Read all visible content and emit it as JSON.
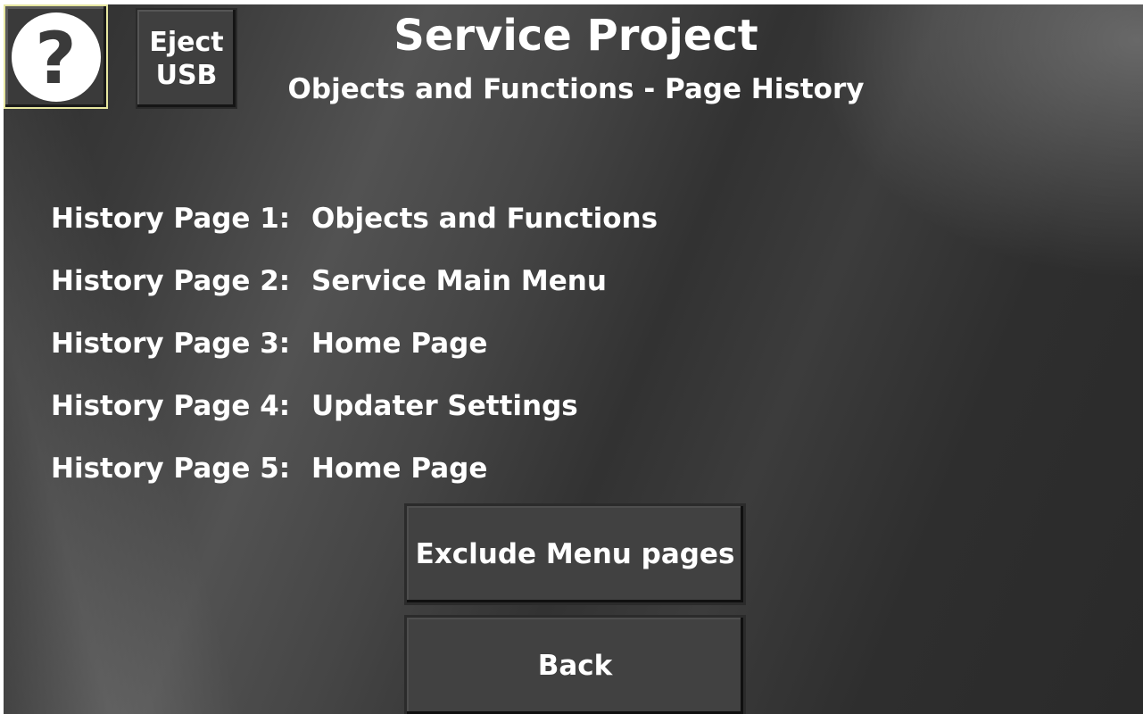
{
  "header": {
    "help_glyph": "?",
    "eject_label": "Eject\nUSB",
    "title": "Service Project",
    "subtitle": "Objects and Functions - Page History"
  },
  "history": [
    {
      "key": "History Page 1:",
      "value": "Objects and Functions"
    },
    {
      "key": "History Page 2:",
      "value": "Service Main Menu"
    },
    {
      "key": "History Page 3:",
      "value": "Home Page"
    },
    {
      "key": "History Page 4:",
      "value": "Updater Settings"
    },
    {
      "key": "History Page 5:",
      "value": "Home Page"
    }
  ],
  "buttons": {
    "exclude_label": "Exclude Menu pages",
    "back_label": "Back"
  },
  "colors": {
    "text": "#ffffff",
    "background": "#3a3a3a",
    "help_border": "#e6e6a0"
  },
  "icons": {
    "help": "question-mark-circle-icon"
  }
}
